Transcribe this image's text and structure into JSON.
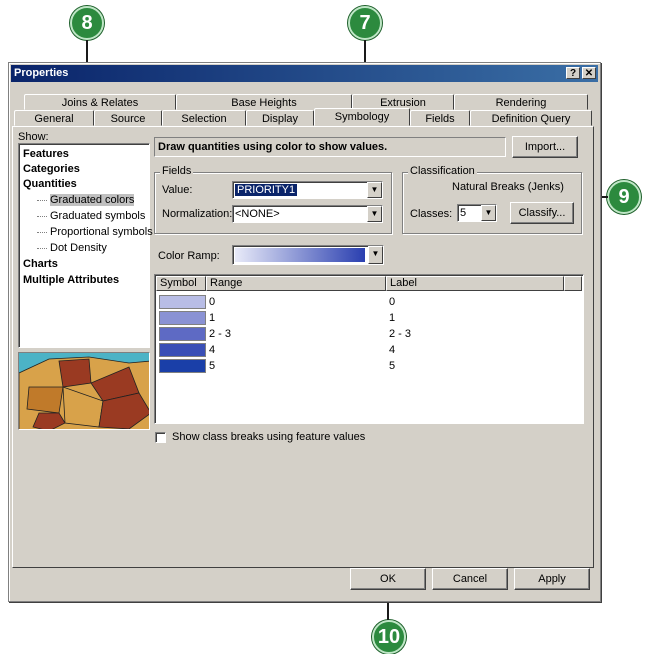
{
  "callouts": {
    "c7": "7",
    "c8": "8",
    "c9": "9",
    "c10": "10"
  },
  "window": {
    "title": "Properties",
    "help_btn": "?",
    "close_btn": "✕"
  },
  "tabs_row1": [
    "Joins & Relates",
    "Base Heights",
    "Extrusion",
    "Rendering"
  ],
  "tabs_row2": [
    "General",
    "Source",
    "Selection",
    "Display",
    "Symbology",
    "Fields",
    "Definition Query"
  ],
  "show": {
    "label": "Show:",
    "items": [
      "Features",
      "Categories",
      "Quantities",
      "Graduated colors",
      "Graduated symbols",
      "Proportional symbols",
      "Dot Density",
      "Charts",
      "Multiple Attributes"
    ],
    "selected": "Graduated colors"
  },
  "description": "Draw quantities using color to show values.",
  "import_btn": "Import...",
  "fields": {
    "group_label": "Fields",
    "value_label": "Value:",
    "value": "PRIORITY1",
    "normalization_label": "Normalization:",
    "normalization": "<NONE>"
  },
  "classification": {
    "group_label": "Classification",
    "method": "Natural Breaks (Jenks)",
    "classes_label": "Classes:",
    "classes": "5",
    "classify_btn": "Classify..."
  },
  "color_ramp_label": "Color Ramp:",
  "table": {
    "headers": [
      "Symbol",
      "Range",
      "Label"
    ],
    "rows": [
      {
        "range": "0",
        "label": "0",
        "color": "#b8bde6"
      },
      {
        "range": "1",
        "label": "1",
        "color": "#8a92d4"
      },
      {
        "range": "2 - 3",
        "label": "2 - 3",
        "color": "#5e6ac4"
      },
      {
        "range": "4",
        "label": "4",
        "color": "#3a4fb6"
      },
      {
        "range": "5",
        "label": "5",
        "color": "#1a3fa8"
      }
    ]
  },
  "show_breaks_label": "Show class breaks using feature values",
  "buttons": {
    "ok": "OK",
    "cancel": "Cancel",
    "apply": "Apply"
  }
}
